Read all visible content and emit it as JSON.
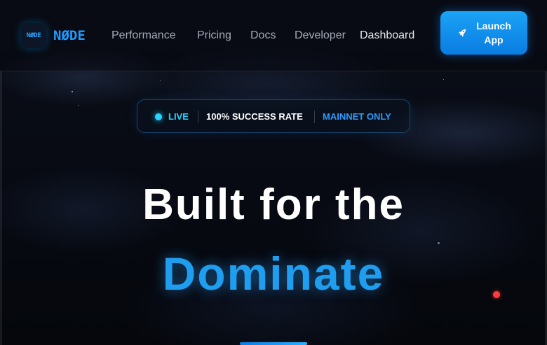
{
  "brand": {
    "logo_mark": "NØDE",
    "name": "NØDE",
    "color": "#1e9bff"
  },
  "nav": {
    "items": [
      {
        "label": "Performance"
      },
      {
        "label": "Pricing"
      },
      {
        "label": "Docs"
      },
      {
        "label": "Developer"
      },
      {
        "label": "Dashboard"
      }
    ]
  },
  "launch_button": {
    "label": "Launch App",
    "icon": "rocket-icon",
    "color": "#0a7ce2"
  },
  "status_pill": {
    "live_label": "LIVE",
    "success_label": "100% SUCCESS RATE",
    "network_label": "MAINNET ONLY",
    "live_color": "#2ad4ff",
    "network_color": "#2e9bff"
  },
  "hero": {
    "line1": "Built for the",
    "line2": "Dominate",
    "accent_color": "#1f9ef0"
  },
  "indicators": {
    "notification_dot_icon": "red-dot-icon",
    "notification_color": "#ff3b3b"
  }
}
